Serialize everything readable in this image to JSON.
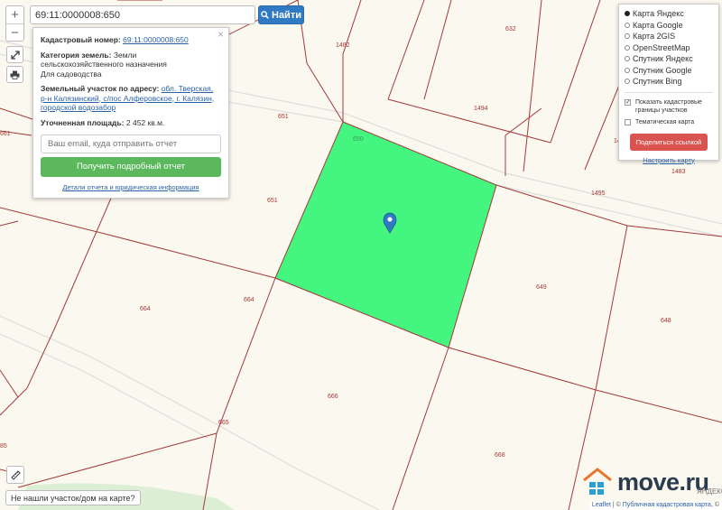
{
  "search": {
    "value": "69:11:0000008:650",
    "button_label": "Найти"
  },
  "controls": {
    "zoom_in": "+",
    "zoom_out": "−"
  },
  "info": {
    "cadastral_label": "Кадастровый номер:",
    "cadastral_value": "69:11:0000008:650",
    "category_label": "Категория земель:",
    "category_value": "Земли сельскохозяйственного назначения",
    "purpose_value": "Для садоводства",
    "address_label": "Земельный участок по адресу:",
    "address_value": "обл. Тверская, р-н Калязинский, с/пос Алферовское, г. Калязин, городской водозабор",
    "area_label": "Уточненная площадь:",
    "area_value": "2 452 кв.м.",
    "email_placeholder": "Ваш email, куда отправить отчет",
    "report_button": "Получить подробный отчет",
    "details_link": "Детали отчета и юридическая информация",
    "close_symbol": "×"
  },
  "layers": {
    "options": [
      {
        "label": "Карта Яндекс",
        "selected": true
      },
      {
        "label": "Карта Google",
        "selected": false
      },
      {
        "label": "Карта 2GIS",
        "selected": false
      },
      {
        "label": "OpenStreetMap",
        "selected": false
      },
      {
        "label": "Спутник Яндекс",
        "selected": false
      },
      {
        "label": "Спутник Google",
        "selected": false
      },
      {
        "label": "Спутник Bing",
        "selected": false
      }
    ],
    "show_borders_label": "Показать кадастровые границы участков",
    "show_borders_checked": true,
    "thematic_label": "Тематическая карта",
    "thematic_checked": false,
    "share_button": "Поделиться ссылкой",
    "configure_link": "Настроить карту"
  },
  "parcel_labels": {
    "p632": "632",
    "p1482": "1482",
    "p1494": "1494",
    "p651a": "651",
    "p651b": "651",
    "p650": "650",
    "p661": "661",
    "p1495": "1495",
    "p1483": "1483",
    "p664a": "664",
    "p664b": "664",
    "p649": "649",
    "p648": "648",
    "p666": "666",
    "p665": "665",
    "p668": "668",
    "p85": "85",
    "p14": "14"
  },
  "help_button": "Не нашли участок/дом на карте?",
  "logo": {
    "text": "move.ru"
  },
  "yandex_mark": "ЯНДЕКС",
  "attribution": {
    "leaflet": "Leaflet",
    "sep": " | © ",
    "source": "Публичная кадастровая карта",
    "tail": ", ©"
  },
  "colors": {
    "parcel_fill": "#44f57f",
    "parcel_line": "#a33a3a",
    "marker": "#2f7ac3",
    "accent_blue": "#2f7ac3"
  }
}
